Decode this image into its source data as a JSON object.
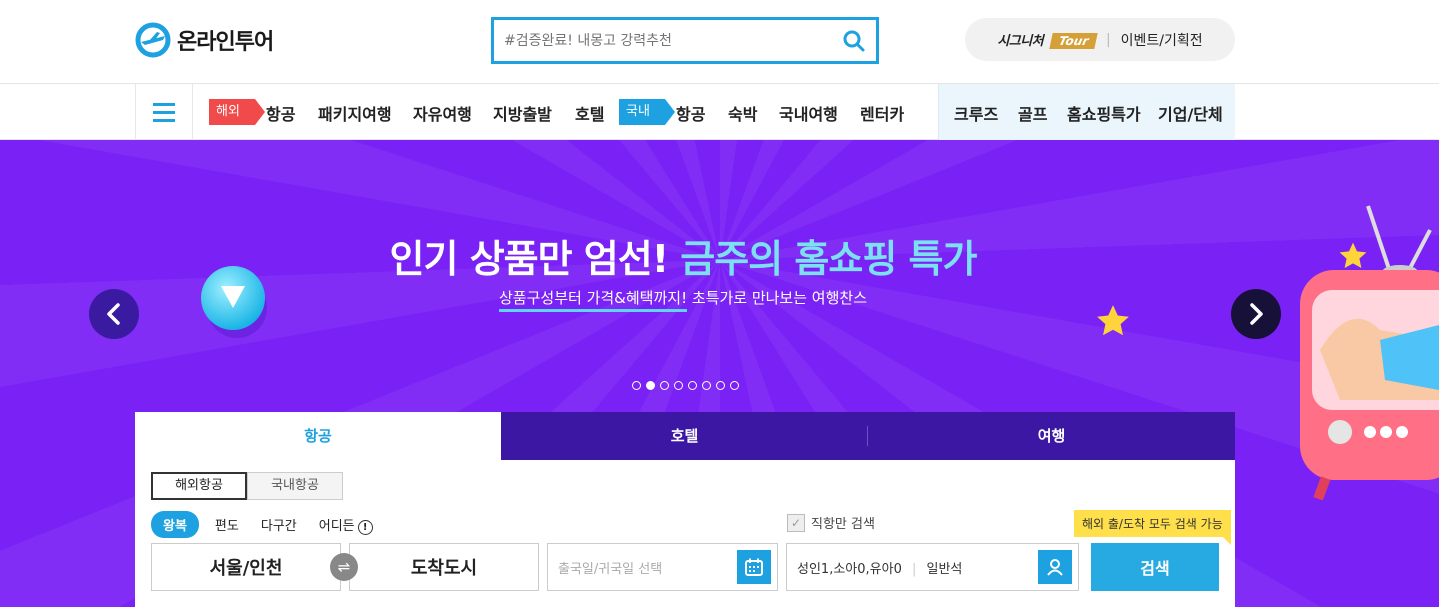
{
  "header": {
    "logo_text": "온라인투어",
    "search_placeholder": "#검증완료! 내몽고 강력추천",
    "signature_label": "시그니처",
    "signature_badge": "Tour",
    "events_label": "이벤트/기획전"
  },
  "nav": {
    "overseas_tag": "해외",
    "overseas_items": [
      "항공",
      "패키지여행",
      "자유여행",
      "지방출발",
      "호텔"
    ],
    "domestic_tag": "국내",
    "domestic_items": [
      "항공",
      "숙박",
      "국내여행",
      "렌터카"
    ],
    "right_items": [
      "크루즈",
      "골프",
      "홈쇼핑특가",
      "기업/단체"
    ]
  },
  "banner": {
    "headline_a": "인기 상품만 엄선! ",
    "headline_b": "금주의 홈쇼핑 특가",
    "sub_underlined": "상품구성부터 가격&혜택까지!",
    "sub_rest": " 초특가로 만나보는 여행찬스",
    "slide_count": 8,
    "active_slide": 2
  },
  "search_panel": {
    "tabs": [
      "항공",
      "호텔",
      "여행"
    ],
    "sub_tabs": [
      "해외항공",
      "국내항공"
    ],
    "trip_types": [
      "왕복",
      "편도",
      "다구간",
      "어디든"
    ],
    "info_glyph": "!",
    "direct_only_label": "직항만 검색",
    "tooltip": "해외 출/도착 모두 검색 가능",
    "from": "서울/인천",
    "to": "도착도시",
    "dates_placeholder": "출국일/귀국일 선택",
    "passengers": "성인1,소아0,유아0",
    "cabin_class": "일반석",
    "search_button": "검색"
  },
  "colors": {
    "accent": "#1ea1e0",
    "banner_bg": "#7a22f5",
    "tab_dark": "#3b17a3",
    "overseas_tag": "#f04a4a",
    "tooltip": "#ffe04a"
  }
}
